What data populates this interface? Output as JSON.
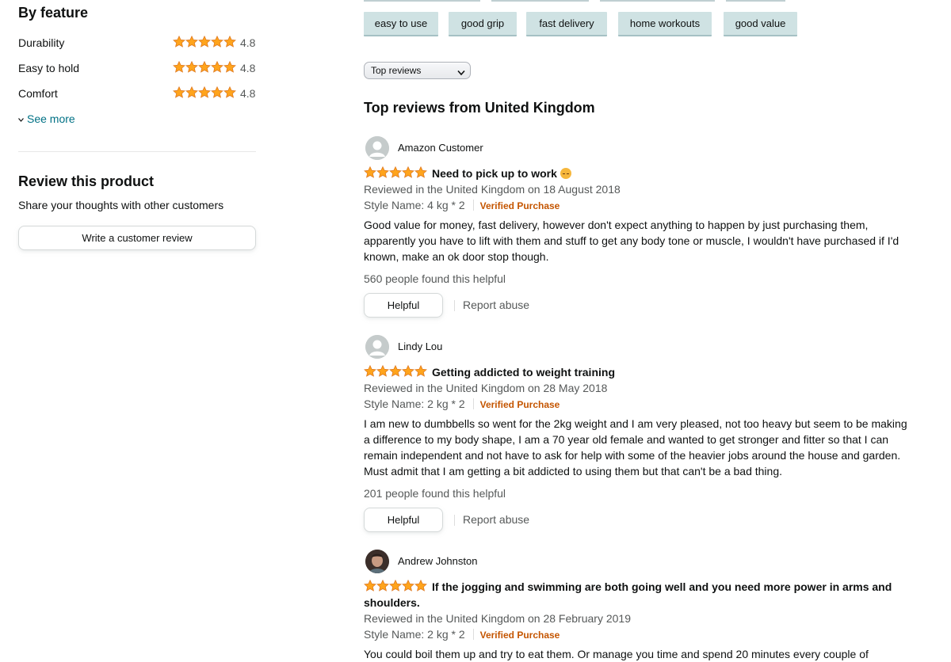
{
  "features": {
    "title": "By feature",
    "items": [
      {
        "name": "Durability",
        "rating": "4.8"
      },
      {
        "name": "Easy to hold",
        "rating": "4.8"
      },
      {
        "name": "Comfort",
        "rating": "4.8"
      }
    ],
    "see_more": "See more"
  },
  "review_product": {
    "title": "Review this product",
    "subtitle": "Share your thoughts with other customers",
    "button": "Write a customer review"
  },
  "chips": [
    "easy to use",
    "good grip",
    "fast delivery",
    "home workouts",
    "good value"
  ],
  "sort": {
    "selected": "Top reviews"
  },
  "reviews_heading": "Top reviews from United Kingdom",
  "reviews": [
    {
      "author": "Amazon Customer",
      "title": "Need to pick up to work",
      "date": "Reviewed in the United Kingdom on 18 August 2018",
      "style": "Style Name: 4 kg * 2",
      "verified": "Verified Purchase",
      "body": "Good value for money, fast delivery, however don't expect anything to happen by just purchasing them, apparently you have to lift with them and stuff to get any body tone or muscle, I wouldn't have purchased if I'd known, make an ok door stop though.",
      "helpful_count": "560 people found this helpful",
      "helpful_button": "Helpful",
      "report": "Report abuse"
    },
    {
      "author": "Lindy Lou",
      "title": "Getting addicted to weight training",
      "date": "Reviewed in the United Kingdom on 28 May 2018",
      "style": "Style Name: 2 kg * 2",
      "verified": "Verified Purchase",
      "body": "I am new to dumbbells so went for the 2kg weight and I am very pleased, not too heavy but seem to be making a difference to my body shape, I am a 70 year old female and wanted to get stronger and fitter so that I can remain independent and not have to ask for help with some of the heavier jobs around the house and garden. Must admit that I am getting a bit addicted to using them but that can't be a bad thing.",
      "helpful_count": "201 people found this helpful",
      "helpful_button": "Helpful",
      "report": "Report abuse"
    },
    {
      "author": "Andrew Johnston",
      "title": "If the jogging and swimming are both going well and you need more power in arms and shoulders.",
      "date": "Reviewed in the United Kingdom on 28 February 2019",
      "style": "Style Name: 2 kg * 2",
      "verified": "Verified Purchase",
      "body": "You could boil them up and try to eat them. Or manage you time and spend 20 minutes every couple of"
    }
  ],
  "colors": {
    "star": "#ffa41c",
    "link": "#007185",
    "verified": "#c45500",
    "chip": "#cfe2e3"
  }
}
